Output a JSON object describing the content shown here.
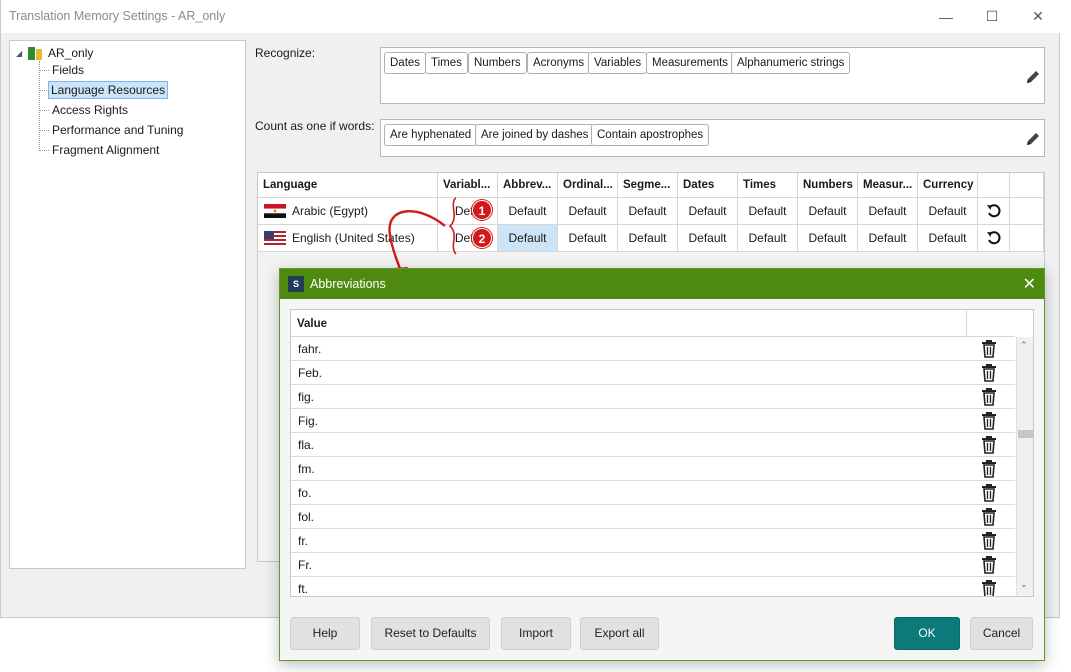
{
  "window": {
    "title": "Translation Memory Settings - AR_only",
    "minimize_glyph": "—",
    "maximize_glyph": "☐",
    "close_glyph": "✕"
  },
  "tree": {
    "root": "AR_only",
    "items": [
      "Fields",
      "Language Resources",
      "Access Rights",
      "Performance and Tuning",
      "Fragment Alignment"
    ],
    "selected": "Language Resources"
  },
  "recognize": {
    "label": "Recognize:",
    "tags": [
      "Dates",
      "Times",
      "Numbers",
      "Acronyms",
      "Variables",
      "Measurements",
      "Alphanumeric strings"
    ]
  },
  "count_as_one": {
    "label": "Count as one if words:",
    "tags": [
      "Are hyphenated",
      "Are joined by dashes",
      "Contain apostrophes"
    ]
  },
  "language_grid": {
    "headers": [
      "Language",
      "Variabl...",
      "Abbrev...",
      "Ordinal...",
      "Segme...",
      "Dates",
      "Times",
      "Numbers",
      "Measur...",
      "Currency"
    ],
    "rows": [
      {
        "language": "Arabic (Egypt)",
        "values": [
          "Defa",
          "Default",
          "Default",
          "Default",
          "Default",
          "Default",
          "Default",
          "Default",
          "Default"
        ],
        "reset_icon": "undo-icon"
      },
      {
        "language": "English (United States)",
        "values": [
          "Defa",
          "Default",
          "Default",
          "Default",
          "Default",
          "Default",
          "Default",
          "Default",
          "Default"
        ],
        "reset_icon": "undo-icon"
      }
    ],
    "highlight_color": "#cce4f7"
  },
  "annotations": {
    "badges": [
      "1",
      "2"
    ],
    "color": "#d11a1a"
  },
  "dialog": {
    "title": "Abbreviations",
    "app_icon_letter": "S",
    "close_glyph": "✕",
    "title_bar_color": "#4f8a10",
    "column_header": "Value",
    "rows": [
      "fahr.",
      "Feb.",
      "fig.",
      "Fig.",
      "fla.",
      "fm.",
      "fo.",
      "fol.",
      "fr.",
      "Fr.",
      "ft."
    ],
    "row_icon": "trash-icon",
    "scroll_up_glyph": "⌃",
    "scroll_down_glyph": "⌄",
    "buttons": {
      "help": "Help",
      "reset": "Reset to Defaults",
      "import": "Import",
      "export": "Export all",
      "ok": "OK",
      "cancel": "Cancel"
    },
    "primary_color": "#0c7a7a"
  }
}
